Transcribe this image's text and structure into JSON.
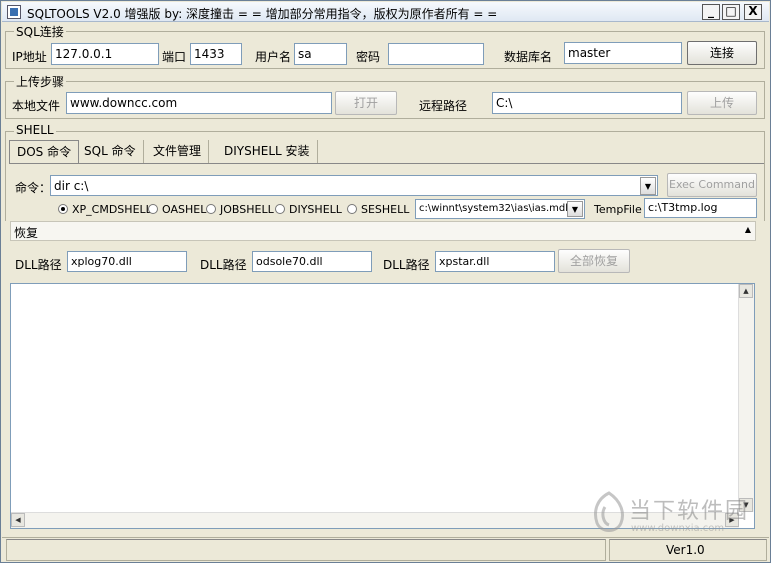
{
  "window": {
    "title": "SQLTOOLS V2.0 增强版   by: 深度撞击    = = 增加部分常用指令，版权为原作者所有 = =",
    "buttons": [
      "_",
      "□",
      "X"
    ]
  },
  "sql_connect": {
    "legend": "SQL连接",
    "ip_label": "IP地址",
    "ip_value": "127.0.0.1",
    "port_label": "端口",
    "port_value": "1433",
    "user_label": "用户名",
    "user_value": "sa",
    "password_label": "密码",
    "password_value": "",
    "db_label": "数据库名",
    "db_value": "master",
    "connect_button": "连接"
  },
  "upload": {
    "legend": "上传步骤",
    "local_label": "本地文件",
    "local_value": "www.downcc.com",
    "open_button": "打开",
    "remote_label": "远程路径",
    "remote_value": "C:\\",
    "upload_button": "上传"
  },
  "shell": {
    "legend": "SHELL",
    "tabs": [
      "DOS 命令",
      "SQL 命令",
      "文件管理",
      "DIYSHELL 安装"
    ],
    "command_label": "命令：",
    "command_value": "dir c:\\",
    "exec_button": "Exec Command",
    "radios": [
      "XP_CMDSHELL",
      "OASHEL",
      "JOBSHELL",
      "DIYSHELL",
      "SESHELL"
    ],
    "selected_radio": "XP_CMDSHELL",
    "mdb_value": "c:\\winnt\\system32\\ias\\ias.mdb",
    "tempfile_label": "TempFile",
    "tempfile_value": "c:\\T3tmp.log"
  },
  "restore": {
    "title": "恢复",
    "dll_label": "DLL路径",
    "dll1": "xplog70.dll",
    "dll2": "odsole70.dll",
    "dll3": "xpstar.dll",
    "restore_all_button": "全部恢复"
  },
  "status": {
    "version": "Ver1.0"
  },
  "watermark": {
    "text": "当下软件园",
    "url": "www.downxia.com"
  }
}
